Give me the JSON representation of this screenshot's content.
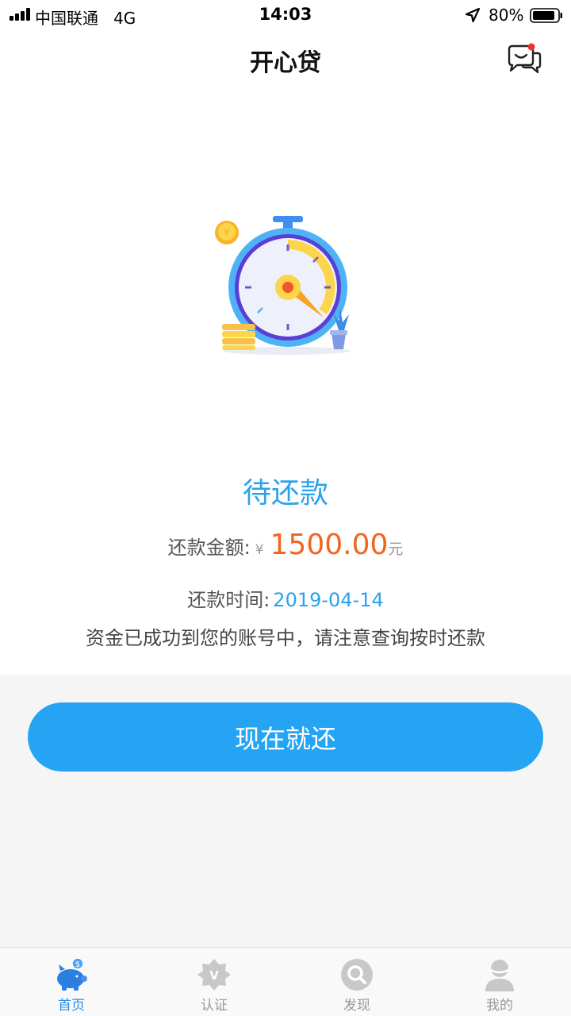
{
  "status_bar": {
    "carrier": "中国联通",
    "network": "4G",
    "time": "14:03",
    "battery": "80%"
  },
  "nav": {
    "title": "开心贷",
    "message_icon": "chat-bubble-icon"
  },
  "loan": {
    "status": "待还款",
    "amount_label": "还款金额:",
    "currency_symbol": "¥",
    "amount": "1500.00",
    "amount_unit": "元",
    "date_label": "还款时间:",
    "date": "2019-04-14",
    "notice": "资金已成功到您的账号中，请注意查询按时还款"
  },
  "actions": {
    "repay_label": "现在就还"
  },
  "tabs": [
    {
      "label": "首页",
      "icon": "piggy-bank-icon",
      "active": true
    },
    {
      "label": "认证",
      "icon": "verify-badge-icon",
      "active": false
    },
    {
      "label": "发现",
      "icon": "discover-search-icon",
      "active": false
    },
    {
      "label": "我的",
      "icon": "user-profile-icon",
      "active": false
    }
  ],
  "colors": {
    "accent": "#25a4f4",
    "amount": "#f2651e",
    "tab_active": "#2a8fe8",
    "tab_inactive": "#c8c8c8"
  }
}
